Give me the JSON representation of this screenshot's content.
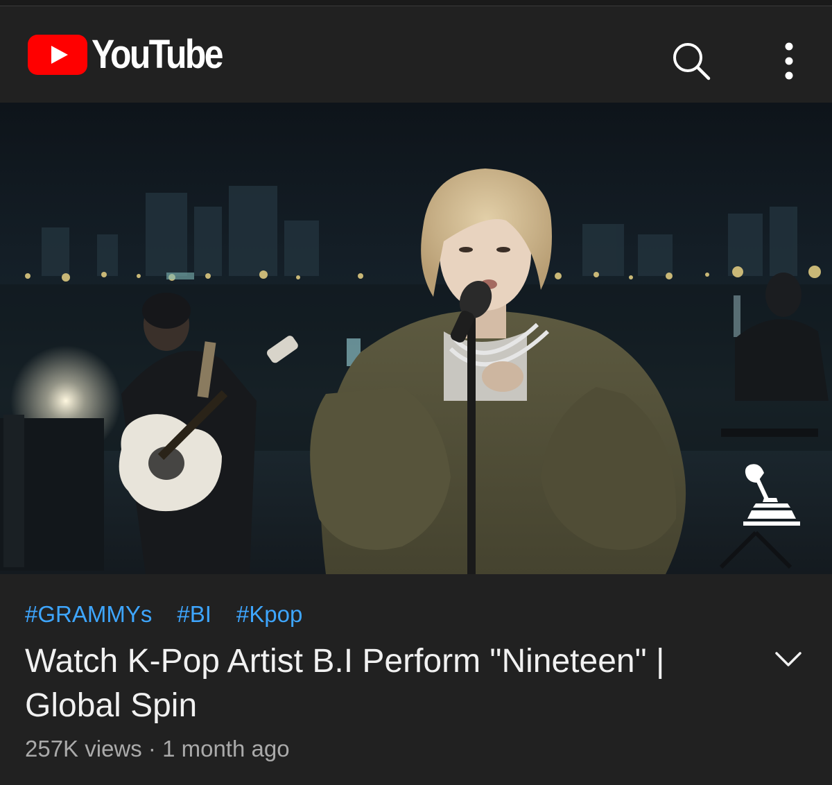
{
  "header": {
    "brand_wordmark": "YouTube",
    "logo_icon": "youtube-play-icon",
    "search_icon": "search-icon",
    "more_icon": "more-vertical-icon"
  },
  "video": {
    "description": "Night riverside performance with singer at microphone and guitarist",
    "badge_icon": "grammy-gramophone-icon"
  },
  "details": {
    "hashtags": [
      "#GRAMMYs",
      "#BI",
      "#Kpop"
    ],
    "title": "Watch K-Pop Artist B.I Perform \"Nineteen\" | Global Spin",
    "meta": "257K views · 1 month ago",
    "expand_icon": "chevron-down-icon"
  },
  "colors": {
    "background": "#212121",
    "brand_red": "#ff0000",
    "hashtag_blue": "#3ea6ff",
    "title_text": "#f1f1f1",
    "meta_text": "#aaaaaa"
  }
}
